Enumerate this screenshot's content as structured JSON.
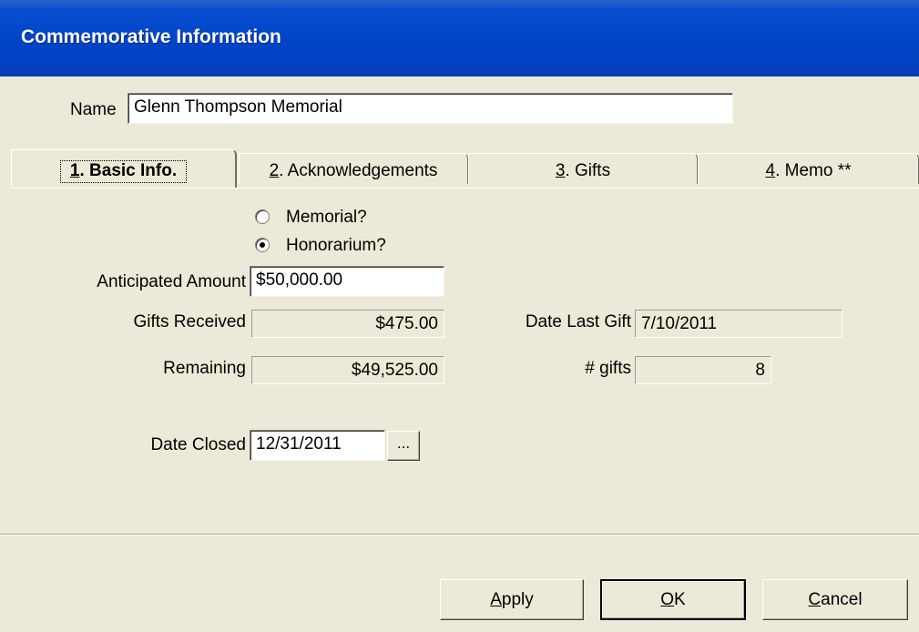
{
  "window": {
    "title": "Commemorative Information"
  },
  "name": {
    "label": "Name",
    "value": "Glenn Thompson Memorial"
  },
  "tabs": [
    {
      "key": "1",
      "label": ". Basic Info.",
      "active": true
    },
    {
      "key": "2",
      "label": ". Acknowledgements",
      "active": false
    },
    {
      "key": "3",
      "label": ". Gifts",
      "active": false
    },
    {
      "key": "4",
      "label": ". Memo **",
      "active": false
    }
  ],
  "basic_info": {
    "memorial_label": "Memorial?",
    "memorial_checked": false,
    "honorarium_label": "Honorarium?",
    "honorarium_checked": true,
    "anticipated_label": "Anticipated Amount",
    "anticipated_value": "$50,000.00",
    "gifts_received_label": "Gifts Received",
    "gifts_received_value": "$475.00",
    "remaining_label": "Remaining",
    "remaining_value": "$49,525.00",
    "date_last_gift_label": "Date Last Gift",
    "date_last_gift_value": "7/10/2011",
    "num_gifts_label": "# gifts",
    "num_gifts_value": "8",
    "date_closed_label": "Date Closed",
    "date_closed_value": "12/31/2011",
    "date_picker_label": "..."
  },
  "buttons": {
    "apply_key": "A",
    "apply_rest": "pply",
    "ok_key": "O",
    "ok_rest": "K",
    "cancel_key": "C",
    "cancel_rest": "ancel"
  }
}
